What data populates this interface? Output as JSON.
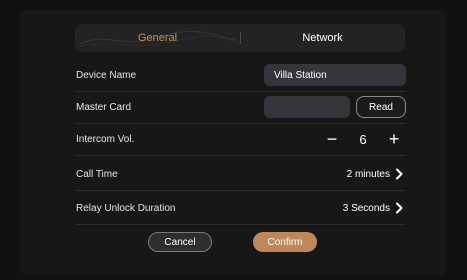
{
  "tabs": [
    {
      "label": "General",
      "active": true
    },
    {
      "label": "Network",
      "active": false
    }
  ],
  "rows": {
    "device_name": {
      "label": "Device Name",
      "value": "Villa Station"
    },
    "master_card": {
      "label": "Master Card",
      "value": "",
      "button": "Read"
    },
    "intercom_vol": {
      "label": "Intercom Vol.",
      "value": "6",
      "minus": "−",
      "plus": "+"
    },
    "call_time": {
      "label": "Call Time",
      "value": "2 minutes"
    },
    "relay_unlock": {
      "label": "Relay Unlock Duration",
      "value": "3 Seconds"
    }
  },
  "buttons": {
    "cancel": "Cancel",
    "confirm": "Confirm"
  },
  "colors": {
    "accent": "#c0875a",
    "background": "#111111",
    "field": "#34363b"
  }
}
